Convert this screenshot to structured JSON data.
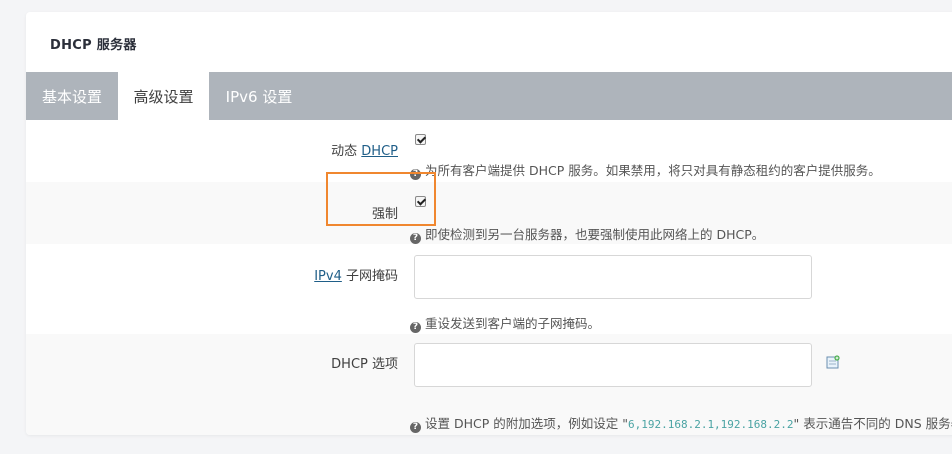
{
  "section": {
    "title": "DHCP 服务器"
  },
  "tabs": [
    {
      "label": "基本设置",
      "active": false
    },
    {
      "label": "高级设置",
      "active": true
    },
    {
      "label": "IPv6 设置",
      "active": false
    }
  ],
  "fields": {
    "dynamic_dhcp": {
      "label_prefix": "动态 ",
      "label_link": "DHCP",
      "checked": true,
      "help": "为所有客户端提供 DHCP 服务。如果禁用，将只对具有静态租约的客户提供服务。"
    },
    "force": {
      "label": "强制",
      "checked": true,
      "help": "即使检测到另一台服务器，也要强制使用此网络上的 DHCP。"
    },
    "ipv4_netmask": {
      "label_link": "IPv4",
      "label_suffix": " 子网掩码",
      "value": "",
      "help": "重设发送到客户端的子网掩码。"
    },
    "dhcp_options": {
      "label": "DHCP 选项",
      "value": "",
      "help_prefix": "设置 DHCP 的附加选项，例如设定 \"",
      "help_code": "6,192.168.2.1,192.168.2.2",
      "help_suffix": "\" 表示通告不同的 DNS 服务器"
    }
  },
  "icons": {
    "help": "question-circle-icon",
    "add": "add-entry-icon"
  },
  "colors": {
    "tabbar": "#aeb4bb",
    "link": "#1f5e88",
    "highlight": "#f0872f"
  }
}
